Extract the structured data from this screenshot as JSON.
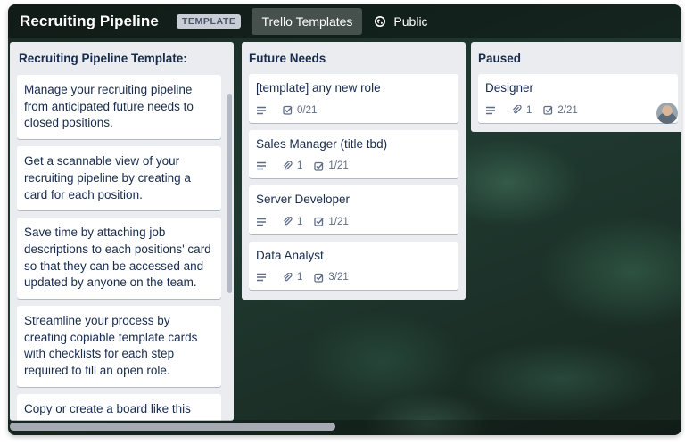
{
  "header": {
    "board_title": "Recruiting Pipeline",
    "badge": "TEMPLATE",
    "templates_button": "Trello Templates",
    "visibility": "Public",
    "visibility_icon": "globe-icon"
  },
  "lists": [
    {
      "title": "Recruiting Pipeline Template:",
      "cards": [
        "Manage your recruiting pipeline from anticipated future needs to closed positions.",
        "Get a scannable view of your recruiting pipeline by creating a card for each position.",
        "Save time by attaching job descriptions to each positions' card so that they can be accessed and updated by anyone on the team.",
        "Streamline your process by creating copiable template cards with checklists for each step required to fill an open role.",
        "Copy or create a board like this board (click for info)"
      ]
    },
    {
      "title": "Future Needs",
      "cards": [
        {
          "title": "[template] any new role",
          "attachments": "",
          "checklist": "0/21"
        },
        {
          "title": "Sales Manager (title tbd)",
          "attachments": "1",
          "checklist": "1/21"
        },
        {
          "title": "Server Developer",
          "attachments": "1",
          "checklist": "1/21"
        },
        {
          "title": "Data Analyst",
          "attachments": "1",
          "checklist": "3/21"
        }
      ]
    },
    {
      "title": "Paused",
      "cards": [
        {
          "title": "Designer",
          "attachments": "1",
          "checklist": "2/21"
        }
      ]
    }
  ]
}
